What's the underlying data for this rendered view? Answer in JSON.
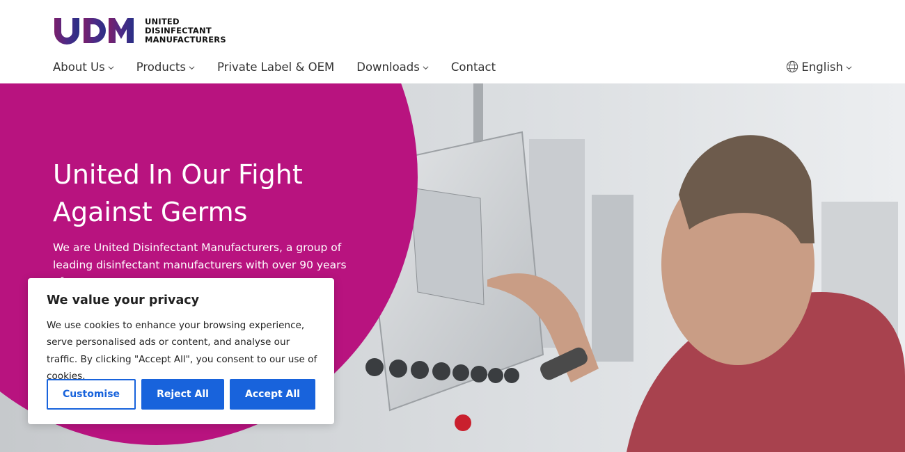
{
  "header": {
    "logo": {
      "mark": "UDM",
      "line1": "UNITED",
      "line2": "DISINFECTANT",
      "line3": "MANUFACTURERS"
    },
    "nav": [
      {
        "label": "About Us",
        "has_dropdown": true
      },
      {
        "label": "Products",
        "has_dropdown": true
      },
      {
        "label": "Private Label & OEM",
        "has_dropdown": false
      },
      {
        "label": "Downloads",
        "has_dropdown": true
      },
      {
        "label": "Contact",
        "has_dropdown": false
      }
    ],
    "language": {
      "label": "English",
      "icon": "globe-icon"
    }
  },
  "hero": {
    "title": "United In Our Fight Against Germs",
    "text": "We are United Disinfectant Manufacturers, a group of leading disinfectant manufacturers with over 90 years of",
    "accent_color": "#b8137f"
  },
  "cookie_banner": {
    "title": "We value your privacy",
    "text": "We use cookies to enhance your browsing experience, serve personalised ads or content, and analyse our traffic. By clicking \"Accept All\", you consent to our use of cookies.",
    "customise_label": "Customise",
    "reject_label": "Reject All",
    "accept_label": "Accept All",
    "button_color": "#1863dc"
  }
}
